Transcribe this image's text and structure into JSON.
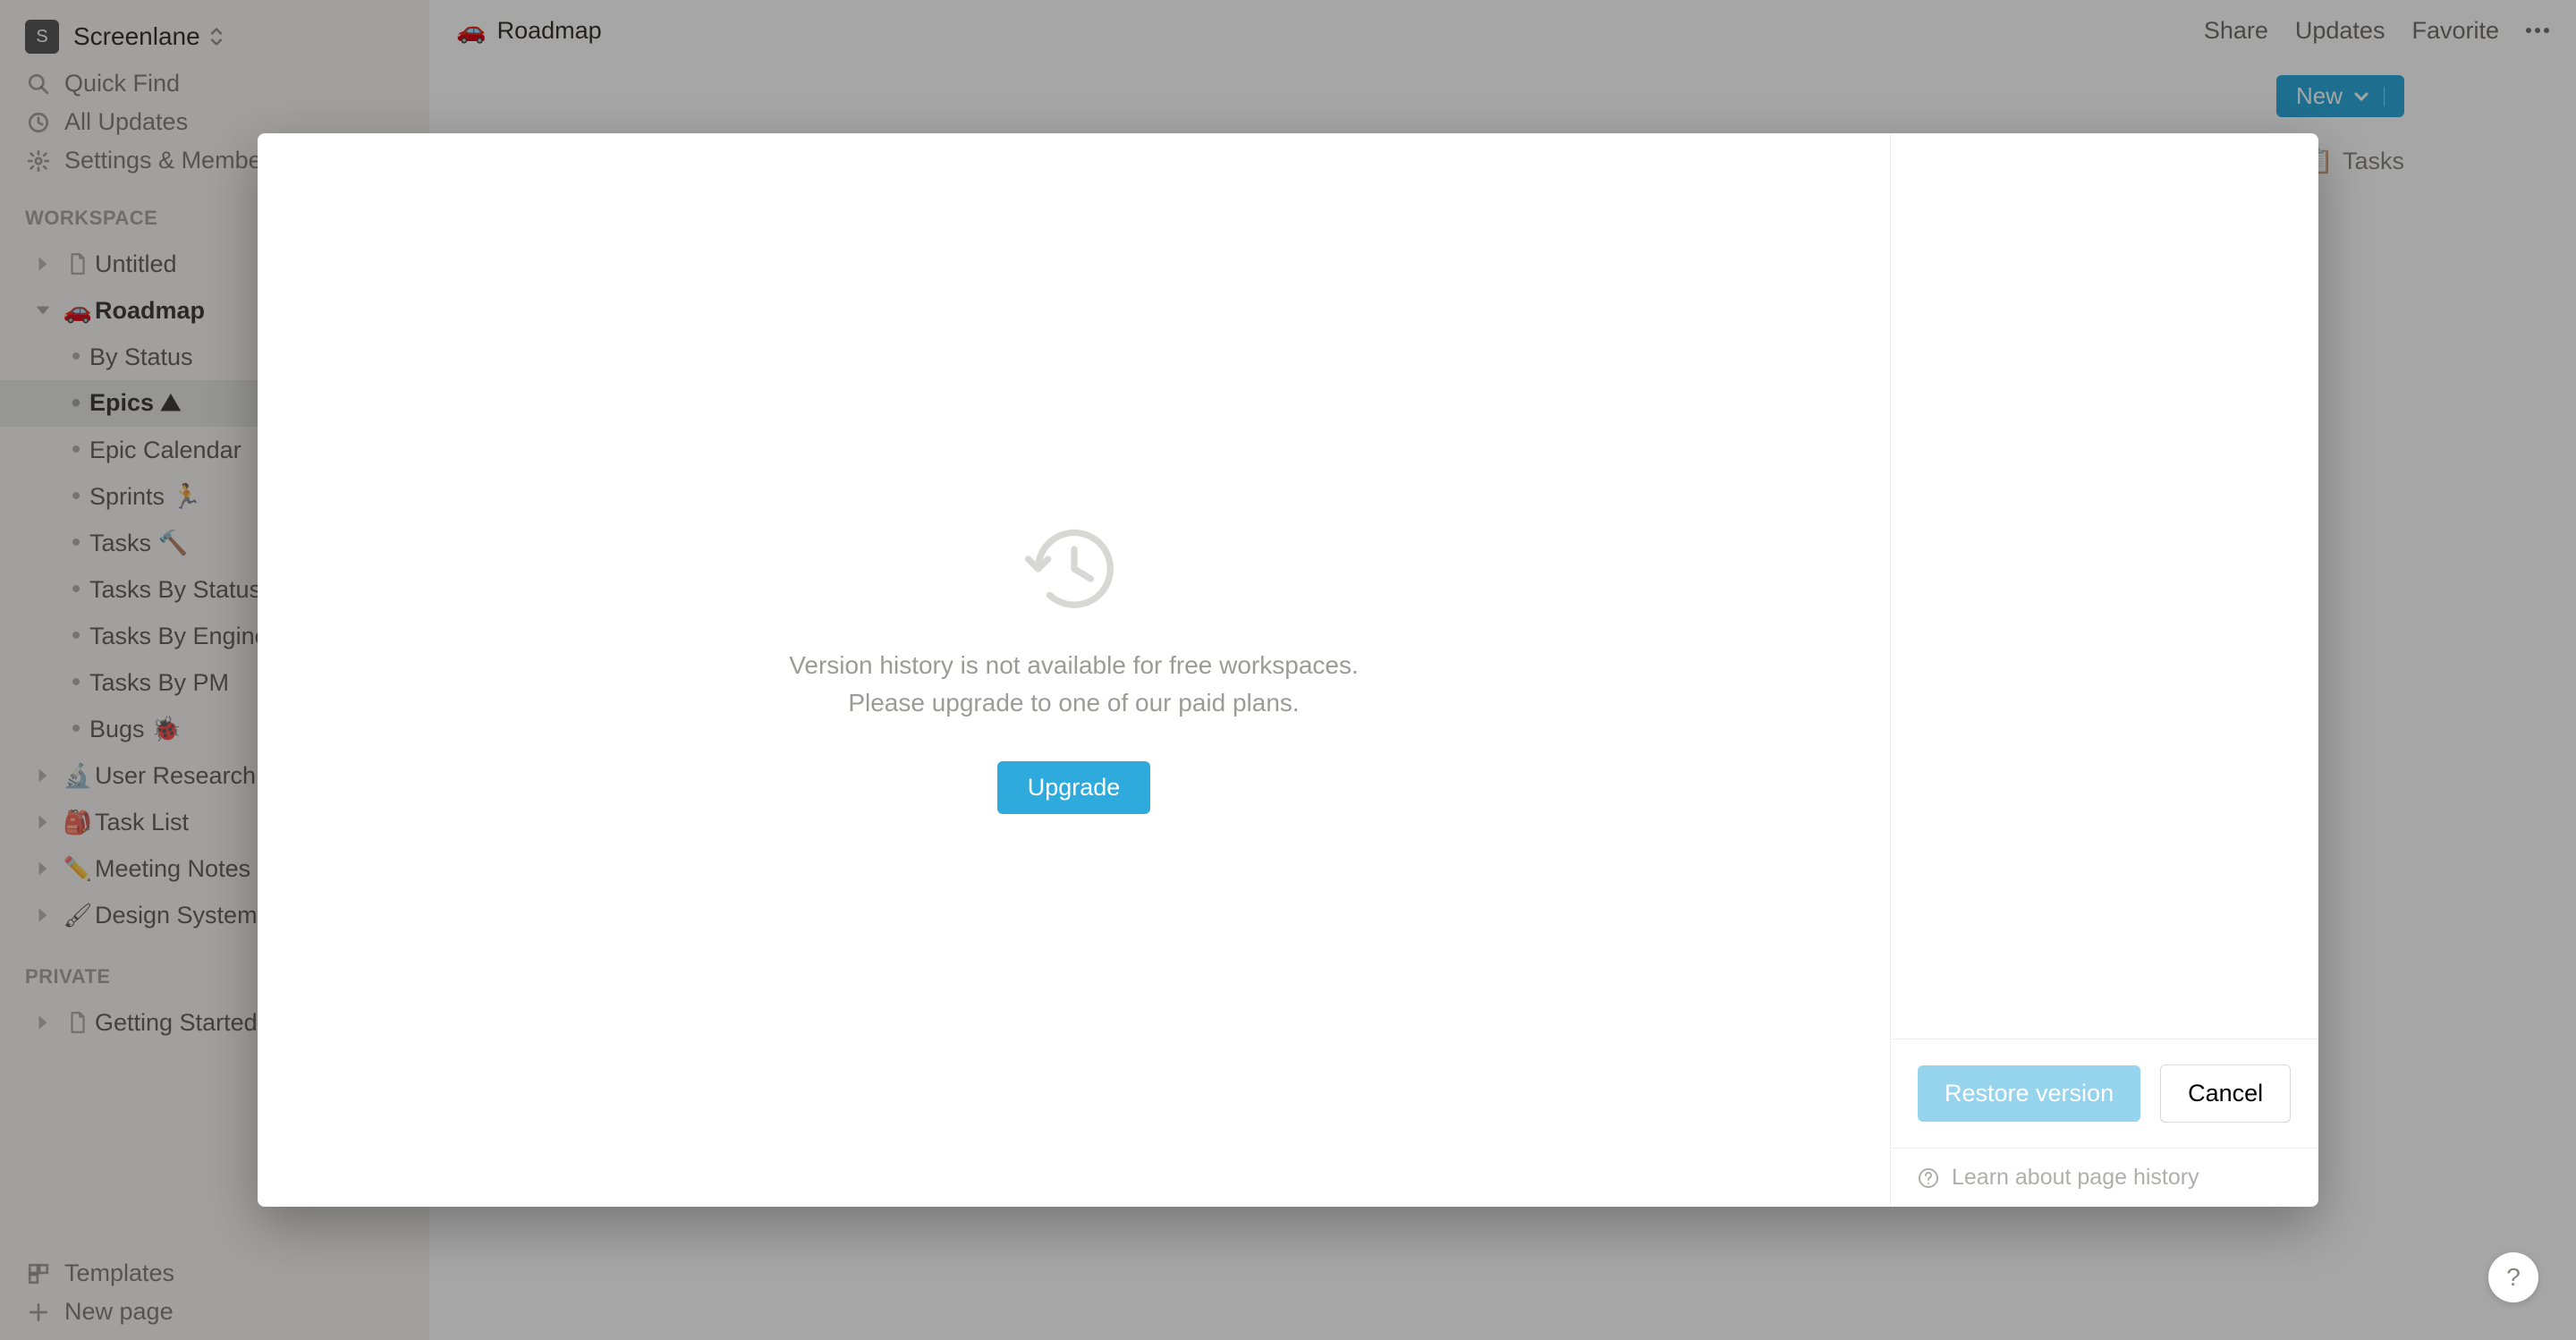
{
  "workspace_name": "Screenlane",
  "workspace_initial": "S",
  "nav": {
    "quick_find": "Quick Find",
    "all_updates": "All Updates",
    "settings": "Settings & Members"
  },
  "sections": {
    "workspace": "WORKSPACE",
    "private": "PRIVATE"
  },
  "tree": {
    "untitled": "Untitled",
    "roadmap": "Roadmap",
    "roadmap_children": {
      "by_status": "By Status",
      "epics": "Epics ⛰",
      "epic_calendar": "Epic Calendar",
      "sprints": "Sprints 🏃",
      "tasks": "Tasks 🔨",
      "tasks_by_status": "Tasks By Status",
      "tasks_by_engineer": "Tasks By Engineer",
      "tasks_by_pm": "Tasks By PM",
      "bugs": "Bugs 🐞"
    },
    "user_research": "User Research",
    "task_list": "Task List",
    "meeting_notes": "Meeting Notes",
    "design_system": "Design System",
    "getting_started": "Getting Started"
  },
  "emojis": {
    "roadmap": "🚗",
    "user_research": "🔬",
    "task_list": "🎒",
    "meeting_notes": "✏️",
    "design_system": "🖌",
    "page": "📄"
  },
  "bottom_nav": {
    "templates": "Templates",
    "new_page": "New page"
  },
  "breadcrumb": {
    "emoji": "🚗",
    "title": "Roadmap"
  },
  "topbar_actions": {
    "share": "Share",
    "updates": "Updates",
    "favorite": "Favorite"
  },
  "main": {
    "new_label": "New",
    "tasks_label": "Tasks",
    "tasks_emoji": "📋"
  },
  "modal": {
    "line1": "Version history is not available for free workspaces.",
    "line2": "Please upgrade to one of our paid plans.",
    "upgrade": "Upgrade",
    "restore": "Restore version",
    "cancel": "Cancel",
    "learn": "Learn about page history"
  },
  "help": "?"
}
